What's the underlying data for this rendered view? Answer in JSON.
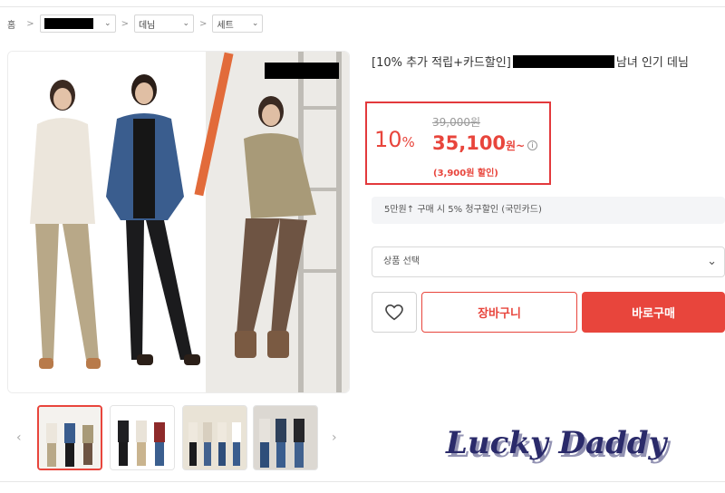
{
  "breadcrumb": {
    "home": "홈",
    "separator": ">",
    "level1": "",
    "level2": "데님",
    "level3": "세트"
  },
  "product": {
    "title_prefix": "[10% 추가 적립+카드할인]",
    "title_suffix": "남녀 인기 데님",
    "brand_redacted": true
  },
  "price": {
    "discount_rate": "10",
    "percent_sign": "%",
    "original": "39,000원",
    "sale": "35,100",
    "sale_unit": "원~",
    "info_icon": "i",
    "discount_note": "(3,900원 할인)"
  },
  "promo": {
    "card_text": "5만원↑ 구매 시 5% 청구할인 (국민카드)"
  },
  "options": {
    "placeholder": "상품 선택"
  },
  "actions": {
    "cart_label": "장바구니",
    "buy_label": "바로구매"
  },
  "thumbnails": {
    "prev_arrow": "‹",
    "next_arrow": "›",
    "count": 4,
    "active_index": 0
  },
  "icons": {
    "heart": "heart-icon",
    "chevron": "chevron-down-icon",
    "info": "info-icon"
  },
  "colors": {
    "accent": "#e8453c",
    "price_box_border": "#e3393c",
    "promo_bg": "#f4f5f7"
  },
  "watermark": {
    "text": "Lucky Daddy"
  }
}
